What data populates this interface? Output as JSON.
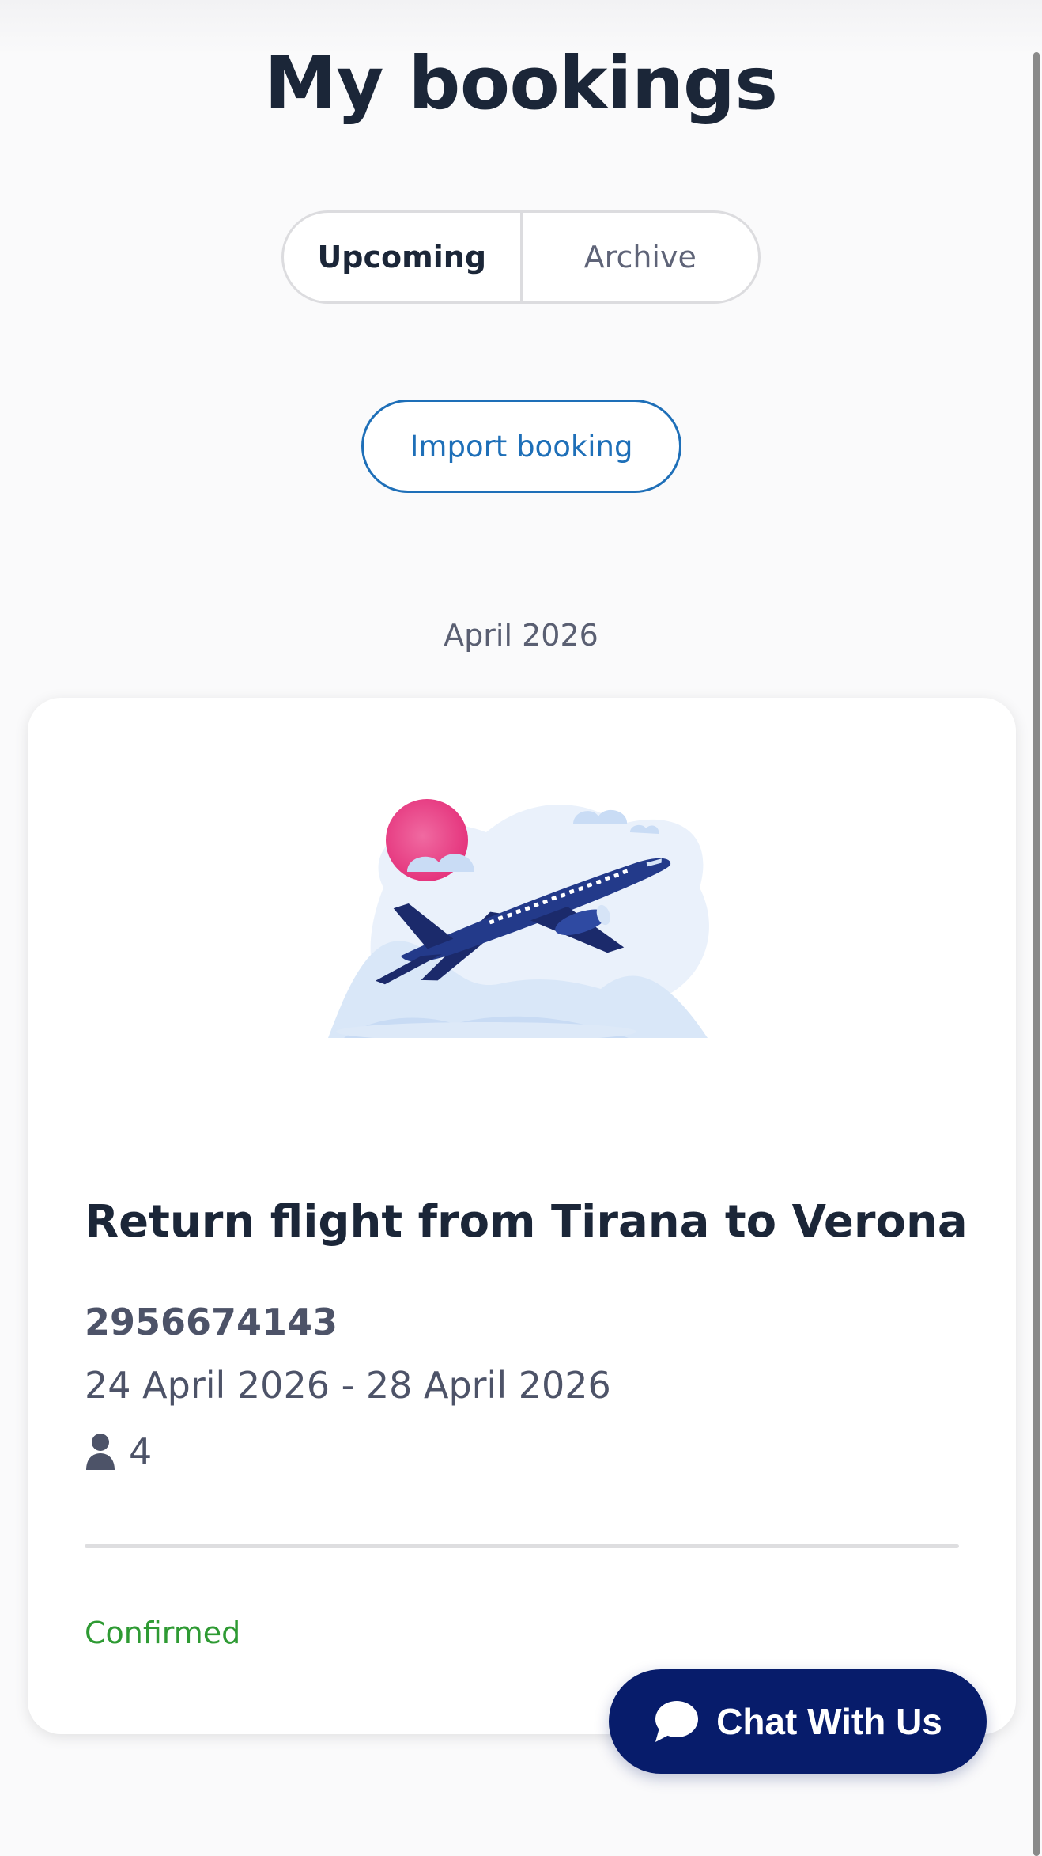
{
  "header": {
    "title": "My bookings"
  },
  "tabs": [
    {
      "label": "Upcoming",
      "active": true
    },
    {
      "label": "Archive",
      "active": false
    }
  ],
  "actions": {
    "import_label": "Import booking"
  },
  "month_group": "April 2026",
  "booking": {
    "title": "Return flight from Tirana to Verona",
    "reference": "2956674143",
    "dates": "24 April 2026 - 28 April 2026",
    "passengers": "4",
    "status": "Confirmed",
    "illustration": "airplane-illustration"
  },
  "chat": {
    "label": "Chat With Us",
    "icon": "chat-bubble-icon"
  },
  "colors": {
    "accent_blue": "#1e6fb8",
    "status_green": "#2e9a33",
    "chat_navy": "#071c6b",
    "text_dark": "#1b2638"
  }
}
